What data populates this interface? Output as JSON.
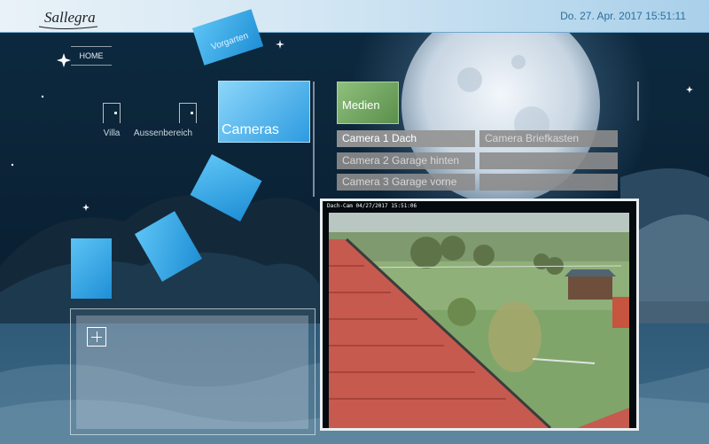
{
  "header": {
    "logo_text": "Sallegra",
    "datetime": "Do. 27. Apr. 2017 15:51:11"
  },
  "nav": {
    "home_label": "HOME",
    "tiles": {
      "vorgarten": "Vorgarten",
      "cameras": "Cameras"
    },
    "rooms": [
      "Villa",
      "Aussenbereich"
    ]
  },
  "medien": {
    "label": "Medien"
  },
  "cameras": {
    "items": [
      "Camera 1 Dach",
      "Camera Briefkasten",
      "Camera 2 Garage hinten",
      "",
      "Camera 3 Garage vorne",
      ""
    ],
    "active_index": 0
  },
  "camera_view": {
    "stamp": "Dach-Cam 04/27/2017 15:51:06"
  },
  "icons": {
    "add": "plus-icon",
    "room": "door-icon"
  },
  "colors": {
    "accent": "#2d9be0",
    "medien": "#6b9f5a",
    "header_text": "#2d6f9b"
  }
}
